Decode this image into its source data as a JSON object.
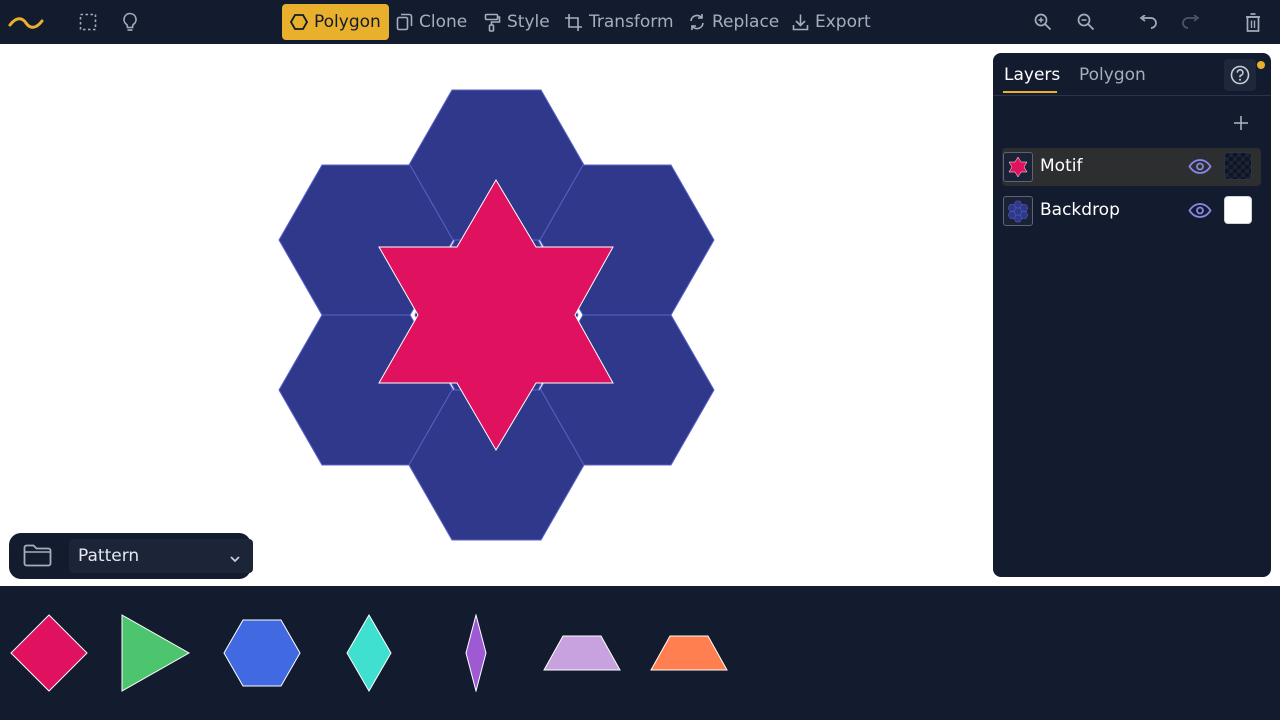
{
  "toolbar": {
    "left_icons": [
      "logo-wave-icon",
      "marquee-select-icon",
      "lightbulb-icon"
    ],
    "tools": [
      {
        "label": "Polygon",
        "icon": "hexagon-outline-icon",
        "active": true
      },
      {
        "label": "Clone",
        "icon": "clone-icon",
        "active": false
      },
      {
        "label": "Style",
        "icon": "paint-roller-icon",
        "active": false
      },
      {
        "label": "Transform",
        "icon": "transform-icon",
        "active": false
      },
      {
        "label": "Replace",
        "icon": "replace-icon",
        "active": false
      },
      {
        "label": "Export",
        "icon": "download-icon",
        "active": false
      }
    ],
    "right_icons": [
      "zoom-in-icon",
      "zoom-out-icon",
      "undo-icon",
      "redo-icon",
      "trash-icon"
    ],
    "accent_color": "#e8b02c"
  },
  "canvas": {
    "background": "#ffffff",
    "hexagon_color": "#2f388a",
    "star_color": "#e0115f"
  },
  "collection": {
    "icon": "folder-icon",
    "selected": "Pattern"
  },
  "layers_panel": {
    "tabs": [
      {
        "label": "Layers",
        "active": true
      },
      {
        "label": "Polygon",
        "active": false
      }
    ],
    "help_icon": "help-circle-icon",
    "add_icon": "plus-icon",
    "layers": [
      {
        "name": "Motif",
        "thumb": "star-thumb-icon",
        "visible": true,
        "selected": true,
        "background": "transparent"
      },
      {
        "name": "Backdrop",
        "thumb": "hexagon-cluster-thumb-icon",
        "visible": true,
        "selected": false,
        "background": "#ffffff"
      }
    ]
  },
  "tray": {
    "shapes": [
      {
        "name": "square",
        "color": "#e0115f"
      },
      {
        "name": "triangle",
        "color": "#4cc56e"
      },
      {
        "name": "hexagon",
        "color": "#4169e1"
      },
      {
        "name": "wide-rhombus",
        "color": "#40e0d0"
      },
      {
        "name": "thin-rhombus",
        "color": "#9d5ad2"
      },
      {
        "name": "wide-trapezoid",
        "color": "#c8a2df"
      },
      {
        "name": "trapezoid",
        "color": "#ff7f50"
      }
    ]
  }
}
